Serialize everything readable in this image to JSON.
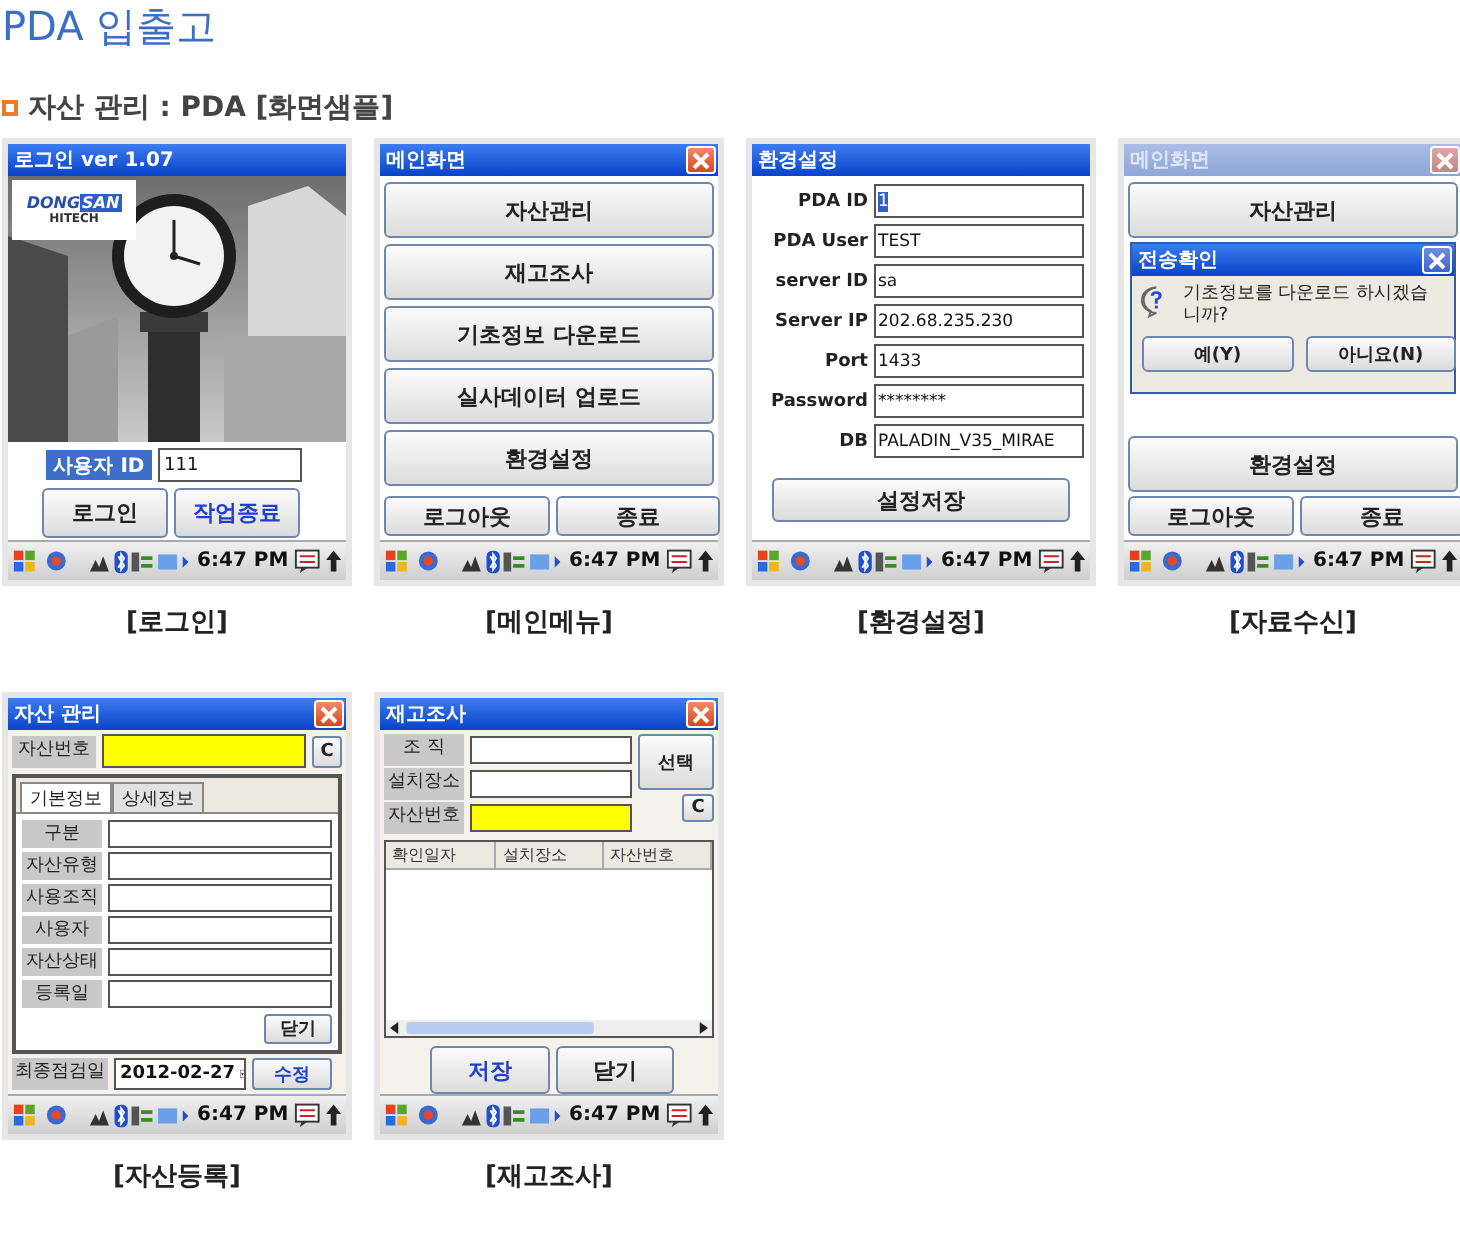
{
  "page_title": "PDA 입출고",
  "section_title": "자산 관리 : PDA [화면샘플]",
  "screens": [
    {
      "kind": "login",
      "title": "로그인 ver 1.07",
      "active": true,
      "closable": false,
      "caption": "[로그인]",
      "time": "6:47 PM",
      "logo": {
        "word": "DONG",
        "highlight": "SAN",
        "sub": "HITECH"
      },
      "id_label": "사용자 ID",
      "id_value": "111",
      "buttons": [
        {
          "label": "로그인",
          "primary": false
        },
        {
          "label": "작업종료",
          "primary": true
        }
      ]
    },
    {
      "kind": "menu",
      "title": "메인화면",
      "active": true,
      "closable": true,
      "caption": "[메인메뉴]",
      "time": "6:47 PM",
      "menu_buttons": [
        "자산관리",
        "재고조사",
        "기초정보 다운로드",
        "실사데이터 업로드",
        "환경설정"
      ],
      "bottom_buttons": [
        "로그아웃",
        "종료"
      ]
    },
    {
      "kind": "settings",
      "title": "환경설정",
      "active": true,
      "closable": false,
      "caption": "[환경설정]",
      "time": "6:47 PM",
      "fields": [
        {
          "label": "PDA ID",
          "value": "1",
          "selected": true
        },
        {
          "label": "PDA User",
          "value": "TEST",
          "selected": false
        },
        {
          "label": "server ID",
          "value": "sa",
          "selected": false
        },
        {
          "label": "Server IP",
          "value": "202.68.235.230",
          "selected": false
        },
        {
          "label": "Port",
          "value": "1433",
          "selected": false
        },
        {
          "label": "Password",
          "value": "********",
          "selected": false
        },
        {
          "label": "DB",
          "value": "PALADIN_V35_MIRAE",
          "selected": false
        }
      ],
      "save_button": "설정저장"
    },
    {
      "kind": "download",
      "title": "메인화면",
      "active": false,
      "closable": true,
      "caption": "[자료수신]",
      "time": "6:47 PM",
      "menu_buttons_top": [
        "자산관리"
      ],
      "menu_buttons_bottom": [
        "환경설정"
      ],
      "bottom_buttons": [
        "로그아웃",
        "종료"
      ],
      "dialog": {
        "title": "전송확인",
        "message": "기초정보를 다운로드 하시겠습니까?",
        "buttons": [
          "예(Y)",
          "아니요(N)"
        ]
      }
    },
    {
      "kind": "asset",
      "title": "자산 관리",
      "active": true,
      "closable": true,
      "caption": "[자산등록]",
      "time": "6:47 PM",
      "asset_no_label": "자산번호",
      "clear_button": "C",
      "tabs": [
        {
          "label": "기본정보",
          "selected": true
        },
        {
          "label": "상세정보",
          "selected": false
        }
      ],
      "fields": [
        "구분",
        "자산유형",
        "사용조직",
        "사용자",
        "자산상태",
        "등록일"
      ],
      "close_button": "닫기",
      "date_label": "최종점검일",
      "date_value": "2012-02-27",
      "edit_button": "수정"
    },
    {
      "kind": "inventory",
      "title": "재고조사",
      "active": true,
      "closable": true,
      "caption": "[재고조사]",
      "time": "6:47 PM",
      "fields": [
        {
          "label": "조 직",
          "highlighted": false
        },
        {
          "label": "설치장소",
          "highlighted": false
        },
        {
          "label": "자산번호",
          "highlighted": true
        }
      ],
      "select_button": "선택",
      "clear_button": "C",
      "columns": [
        "확인일자",
        "설치장소",
        "자산번호"
      ],
      "buttons": [
        {
          "label": "저장",
          "primary": true
        },
        {
          "label": "닫기",
          "primary": false
        }
      ]
    }
  ]
}
